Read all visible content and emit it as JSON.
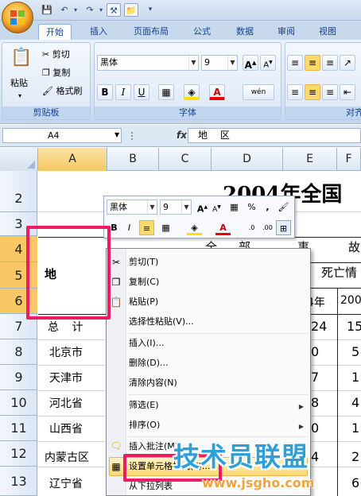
{
  "ribbon": {
    "tabs": [
      "开始",
      "插入",
      "页面布局",
      "公式",
      "数据",
      "审阅",
      "视图"
    ],
    "clipboard": {
      "paste": "粘贴",
      "cut": "剪切",
      "copy": "复制",
      "format_painter": "格式刷",
      "label": "剪贴板"
    },
    "font": {
      "name": "黑体",
      "size": "9",
      "label": "字体",
      "bold": "B",
      "italic": "I",
      "underline": "U",
      "grow": "A",
      "shrink": "A",
      "phonetic": "wén"
    },
    "align": {
      "label": "对齐"
    }
  },
  "formula_bar": {
    "name_box": "A4",
    "fx": "fx",
    "content": "地 区"
  },
  "columns": [
    "A",
    "B",
    "C",
    "D",
    "E",
    "F"
  ],
  "rows": [
    "2",
    "3",
    "4",
    "5",
    "6",
    "7",
    "8",
    "9",
    "10",
    "11",
    "12",
    "13"
  ],
  "sheet": {
    "title": "2004年全国",
    "header_all": "全",
    "header_dept": "部",
    "header_event": "事",
    "header_cause": "故",
    "header_death": "死亡情",
    "a4": "地 区",
    "year_e": "4年",
    "year_f": "200",
    "rows": [
      {
        "a": "总  计",
        "e": "24",
        "f": "15"
      },
      {
        "a": "北京市",
        "e": "0",
        "f": "5"
      },
      {
        "a": "天津市",
        "e": "7",
        "f": "1"
      },
      {
        "a": "河北省",
        "e": "8",
        "f": "4"
      },
      {
        "a": "山西省",
        "e": "0",
        "f": "1"
      },
      {
        "a": "内蒙古区",
        "e": "4",
        "f": "2"
      },
      {
        "a": "辽宁省",
        "e": "",
        "f": "6"
      }
    ]
  },
  "mini_toolbar": {
    "font": "黑体",
    "size": "9",
    "percent": "%",
    "comma": ","
  },
  "context_menu": {
    "items": [
      {
        "label": "剪切(T)",
        "icon": "scissors-icon"
      },
      {
        "label": "复制(C)",
        "icon": "copy-icon"
      },
      {
        "label": "粘贴(P)",
        "icon": "paste-icon"
      },
      {
        "label": "选择性粘贴(V)...",
        "icon": ""
      },
      {
        "label": "插入(I)...",
        "icon": ""
      },
      {
        "label": "删除(D)...",
        "icon": ""
      },
      {
        "label": "清除内容(N)",
        "icon": ""
      },
      {
        "label": "筛选(E)",
        "icon": ""
      },
      {
        "label": "排序(O)",
        "icon": ""
      },
      {
        "label": "插入批注(M)",
        "icon": "comment-icon"
      },
      {
        "label": "设置单元格格式(F)...",
        "icon": "format-cells-icon"
      },
      {
        "label": "从下拉列表",
        "icon": ""
      }
    ]
  },
  "watermark": {
    "cn": "技术员联盟",
    "url": "www.jsgho.com"
  },
  "colors": {
    "accent_red": "#ee1a63",
    "highlight": "#ffd86e"
  }
}
